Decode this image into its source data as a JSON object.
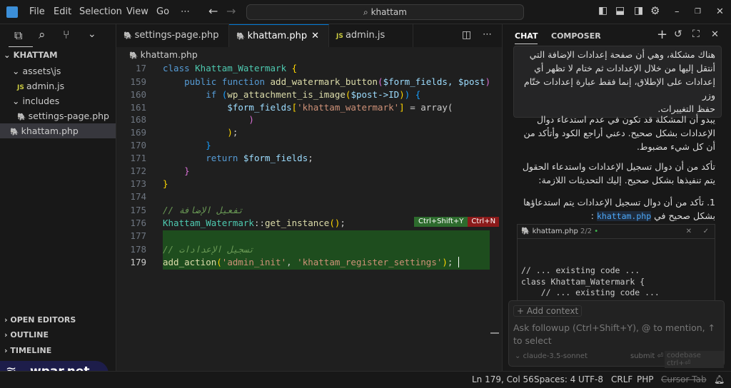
{
  "menu": {
    "items": [
      "File",
      "Edit",
      "Selection",
      "View",
      "Go",
      "⋯"
    ],
    "search": "khattam"
  },
  "explorer": {
    "root": "KHATTAM",
    "items": [
      {
        "label": "assets\\js",
        "type": "folder"
      },
      {
        "label": "admin.js",
        "type": "js"
      },
      {
        "label": "includes",
        "type": "folder"
      },
      {
        "label": "settings-page.php",
        "type": "php"
      },
      {
        "label": "khattam.php",
        "type": "php",
        "selected": true
      }
    ],
    "sections": [
      "OPEN EDITORS",
      "OUTLINE",
      "TIMELINE"
    ]
  },
  "tabs": [
    {
      "label": "settings-page.php"
    },
    {
      "label": "khattam.php",
      "active": true
    },
    {
      "label": "admin.js"
    }
  ],
  "breadcrumb": "khattam.php",
  "code": {
    "lines": [
      "17",
      "159",
      "160",
      "161",
      "168",
      "169",
      "170",
      "171",
      "172",
      "173",
      "174",
      "175",
      "176",
      "177",
      "178",
      "179"
    ],
    "comment1": "// تفعيل الإضافة",
    "comment2": "// تسجيل الإعدادات",
    "accept_hint": "Ctrl+Shift+Y",
    "reject_hint": "Ctrl+N",
    "l17a": "class ",
    "l17b": "Khattam_Watermark",
    "l159a": "public function ",
    "l159b": "add_watermark_button",
    "l159c": "$form_fields, $post",
    "l160a": "if ",
    "l160b": "wp_attachment_is_image",
    "l160c": "$post->",
    "l160d": "ID",
    "l161a": "$form_fields",
    "l161b": "'khattam_watermark'",
    "l161c": " = array(",
    "l171a": "return ",
    "l171b": "$form_fields",
    "l176a": "Khattam_Watermark",
    "l176b": "get_instance",
    "l179a": "add_action",
    "l179b": "'admin_init'",
    "l179c": "'khattam_register_settings'"
  },
  "chat": {
    "tabs": [
      "CHAT",
      "COMPOSER"
    ],
    "user_msg": [
      "هناك مشكلة، وهي أن صفحة إعدادات الإضافة التي",
      "أنتقل إليها من خلال الإعدادات ثم ختام لا تظهر أي",
      "إعدادات على الإطلاق، إنما فقط عبارة إعدادات ختّام وزر",
      "حفظ التغييرات."
    ],
    "p1": "يبدو أن المشكلة قد تكون في عدم استدعاء دوال الإعدادات بشكل صحيح. دعني أراجع الكود وأتأكد من أن كل شيء مضبوط.",
    "p2": "تأكد من أن دوال تسجيل الإعدادات واستدعاء الحقول يتم تنفيذها بشكل صحيح. إليك التحديثات اللازمة:",
    "p3": "1. تأكد من أن دوال تسجيل الإعدادات يتم استدعاؤها بشكل صحيح في",
    "p3_code": "khattam.php",
    "block": {
      "file": "khattam.php",
      "count": "2/2",
      "lines": [
        "// ... existing code ...",
        "",
        "class Khattam_Watermark {",
        "    // ... existing code ..."
      ]
    },
    "add_context": "+ Add context",
    "placeholder": "Ask followup (Ctrl+Shift+Y), @ to mention, ↑ to select",
    "model": "claude-3.5-sonnet",
    "submit": "submit ⏎",
    "codebase": "codebase ctrl+⏎"
  },
  "status": {
    "position": "Ln 179, Col 56",
    "spaces": "Spaces: 4",
    "encoding": "UTF-8",
    "eol": "CRLF",
    "language": "PHP",
    "cursor_tab": "Cursor Tab"
  },
  "watermark": "wpar.net",
  "colors": {
    "accent": "#0078d4",
    "diff_added": "#1e4d1e",
    "accept": "#2d6b2d",
    "reject": "#8b1a1a"
  }
}
